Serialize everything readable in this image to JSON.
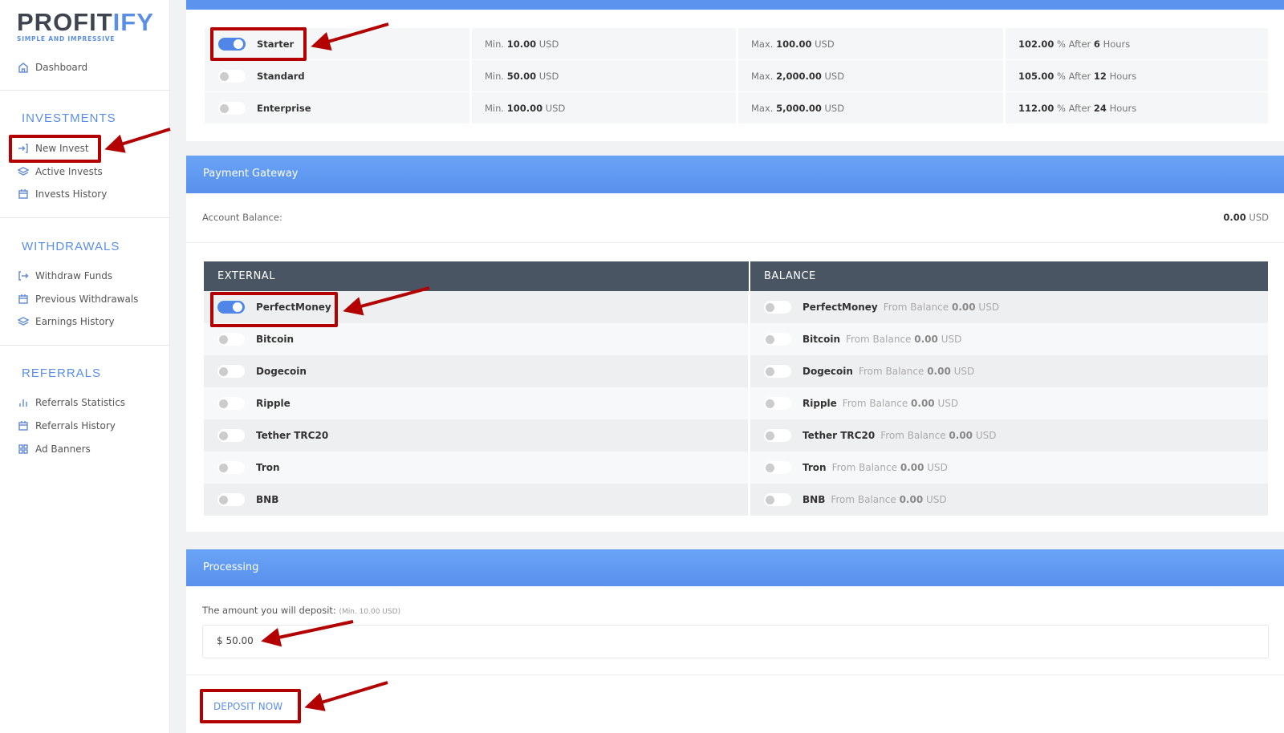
{
  "brand": {
    "name_a": "PROFIT",
    "name_b": "IFY",
    "tagline": "SIMPLE AND IMPRESSIVE"
  },
  "sidebar": {
    "dashboard": "Dashboard",
    "investments": {
      "title": "INVESTMENTS",
      "items": [
        "New Invest",
        "Active Invests",
        "Invests History"
      ]
    },
    "withdrawals": {
      "title": "WITHDRAWALS",
      "items": [
        "Withdraw Funds",
        "Previous Withdrawals",
        "Earnings History"
      ]
    },
    "referrals": {
      "title": "REFERRALS",
      "items": [
        "Referrals Statistics",
        "Referrals History",
        "Ad Banners"
      ]
    }
  },
  "plans": [
    {
      "name": "Starter",
      "min": "10.00",
      "max": "100.00",
      "percent": "102.00",
      "hours": "6",
      "selected": true
    },
    {
      "name": "Standard",
      "min": "50.00",
      "max": "2,000.00",
      "percent": "105.00",
      "hours": "12",
      "selected": false
    },
    {
      "name": "Enterprise",
      "min": "100.00",
      "max": "5,000.00",
      "percent": "112.00",
      "hours": "24",
      "selected": false
    }
  ],
  "labels": {
    "min": "Min.",
    "max": "Max.",
    "usd": "USD",
    "pct_after": "% After",
    "hours": "Hours",
    "from_balance": "From Balance"
  },
  "gateway": {
    "title": "Payment Gateway",
    "balance_label": "Account Balance:",
    "balance_value": "0.00",
    "balance_unit": "USD",
    "col_external": "EXTERNAL",
    "col_balance": "BALANCE",
    "methods": [
      {
        "name": "PerfectMoney",
        "balance": "0.00",
        "selected": true
      },
      {
        "name": "Bitcoin",
        "balance": "0.00",
        "selected": false
      },
      {
        "name": "Dogecoin",
        "balance": "0.00",
        "selected": false
      },
      {
        "name": "Ripple",
        "balance": "0.00",
        "selected": false
      },
      {
        "name": "Tether TRC20",
        "balance": "0.00",
        "selected": false
      },
      {
        "name": "Tron",
        "balance": "0.00",
        "selected": false
      },
      {
        "name": "BNB",
        "balance": "0.00",
        "selected": false
      }
    ]
  },
  "processing": {
    "title": "Processing",
    "amount_label": "The amount you will deposit:",
    "amount_hint": "(Min. 10.00 USD)",
    "amount_value": "$ 50.00",
    "submit": "DEPOSIT NOW"
  },
  "colors": {
    "accent": "#5b8fe6",
    "header_dark": "#4a5563",
    "annotation": "#b30000"
  }
}
